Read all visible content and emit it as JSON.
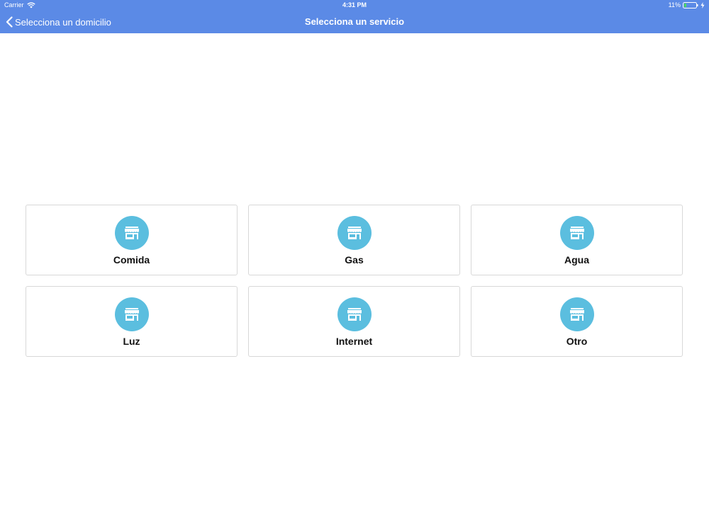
{
  "status_bar": {
    "carrier": "Carrier",
    "time": "4:31 PM",
    "battery": "11%",
    "wifi_icon": "wifi-icon",
    "battery_icon": "battery-icon",
    "charge_icon": "charging-bolt-icon"
  },
  "nav": {
    "back_label": "Selecciona un domicilio",
    "back_icon": "chevron-left-icon",
    "title": "Selecciona un servicio"
  },
  "colors": {
    "navbar": "#5b8ae6",
    "icon_circle": "#5bbedf",
    "card_border": "#d8d8d8"
  },
  "services": [
    {
      "label": "Comida",
      "icon": "store-icon"
    },
    {
      "label": "Gas",
      "icon": "store-icon"
    },
    {
      "label": "Agua",
      "icon": "store-icon"
    },
    {
      "label": "Luz",
      "icon": "store-icon"
    },
    {
      "label": "Internet",
      "icon": "store-icon"
    },
    {
      "label": "Otro",
      "icon": "store-icon"
    }
  ]
}
